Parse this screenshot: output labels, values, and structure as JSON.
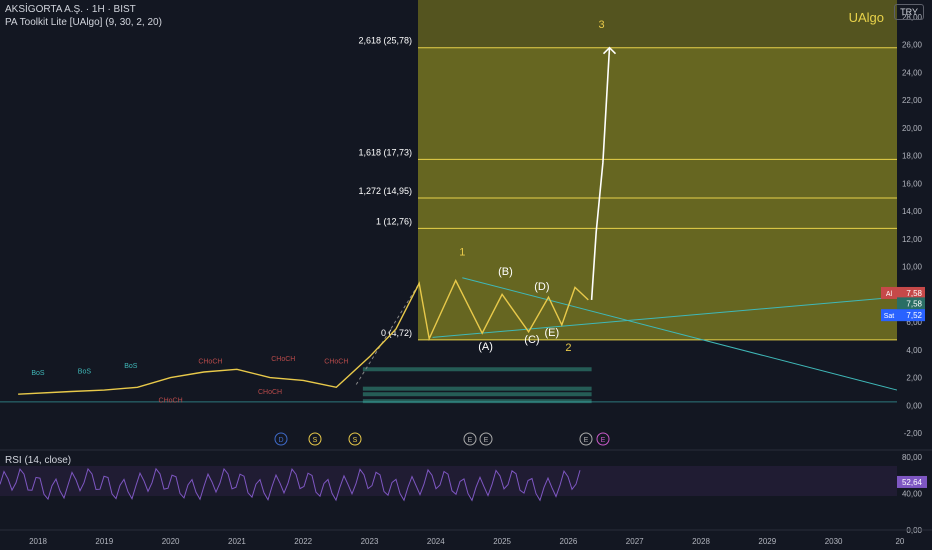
{
  "header": {
    "symbol": "AKSİGORTA A.Ş. · 1H · BIST",
    "indicator": "PA Toolkit Lite [UAlgo] (9, 30, 2, 20)",
    "currency": "TRY",
    "brand": "UAlgo"
  },
  "rsi": {
    "title": "RSI (14, close)",
    "last": "52,64",
    "level": "80,00"
  },
  "price_tags": {
    "buy_label": "Al",
    "buy": "7,58",
    "mid": "7,58",
    "sell_label": "Sat",
    "sell": "7,52"
  },
  "fib_levels": [
    {
      "label": "2,618 (25,78)",
      "value": 25.78
    },
    {
      "label": "1,618 (17,73)",
      "value": 17.73
    },
    {
      "label": "1,272 (14,95)",
      "value": 14.95
    },
    {
      "label": "1 (12,76)",
      "value": 12.76
    },
    {
      "label": "0 (4,72)",
      "value": 4.72
    }
  ],
  "wave_labels": [
    "1",
    "2",
    "3",
    "(A)",
    "(B)",
    "(C)",
    "(D)",
    "(E)"
  ],
  "structure_labels": [
    "BoS",
    "CHoCH"
  ],
  "event_markers": [
    "D",
    "S",
    "S",
    "E",
    "E",
    "E",
    "E"
  ],
  "colors": {
    "bg": "#131722",
    "fib_zone": "#6b6a1f",
    "fib_line": "#e8d24a",
    "wave": "#e8c94a",
    "trend": "#3fb8b8",
    "price": "#4d9a8f",
    "rsi": "#7e57c2"
  },
  "chart_data": {
    "type": "line",
    "y_ticks": [
      "28,00",
      "26,00",
      "24,00",
      "22,00",
      "20,00",
      "18,00",
      "16,00",
      "14,00",
      "12,00",
      "10,00",
      "8,00",
      "6,00",
      "4,00",
      "2,00",
      "0,00",
      "-2,00"
    ],
    "rsi_ticks": [
      "80,00",
      "40,00",
      "0,00"
    ],
    "x_ticks": [
      "2018",
      "2019",
      "2020",
      "2021",
      "2022",
      "2023",
      "2024",
      "2025",
      "2026",
      "2027",
      "2028",
      "2029",
      "2030",
      "20"
    ],
    "ylim": [
      -2.5,
      28.5
    ],
    "series": [
      {
        "points": [
          [
            2017.7,
            0.8
          ],
          [
            2018.5,
            1.0
          ],
          [
            2019.0,
            1.1
          ],
          [
            2019.5,
            1.3
          ],
          [
            2020.0,
            2.0
          ],
          [
            2020.5,
            2.4
          ],
          [
            2021.0,
            2.6
          ],
          [
            2021.5,
            2.0
          ],
          [
            2022.0,
            1.8
          ],
          [
            2022.5,
            1.3
          ],
          [
            2023.0,
            3.5
          ],
          [
            2023.4,
            5.5
          ],
          [
            2023.75,
            8.8
          ],
          [
            2023.9,
            4.8
          ],
          [
            2024.3,
            9.0
          ],
          [
            2024.7,
            5.2
          ],
          [
            2025.0,
            8.0
          ],
          [
            2025.4,
            5.3
          ],
          [
            2025.7,
            7.8
          ],
          [
            2025.9,
            5.8
          ],
          [
            2026.1,
            8.5
          ],
          [
            2026.3,
            7.6
          ]
        ]
      },
      {
        "name": "3",
        "points": [
          [
            2026.35,
            7.6
          ],
          [
            2026.42,
            12.5
          ],
          [
            2026.52,
            17.5
          ],
          [
            2026.62,
            25.78
          ]
        ]
      }
    ]
  }
}
